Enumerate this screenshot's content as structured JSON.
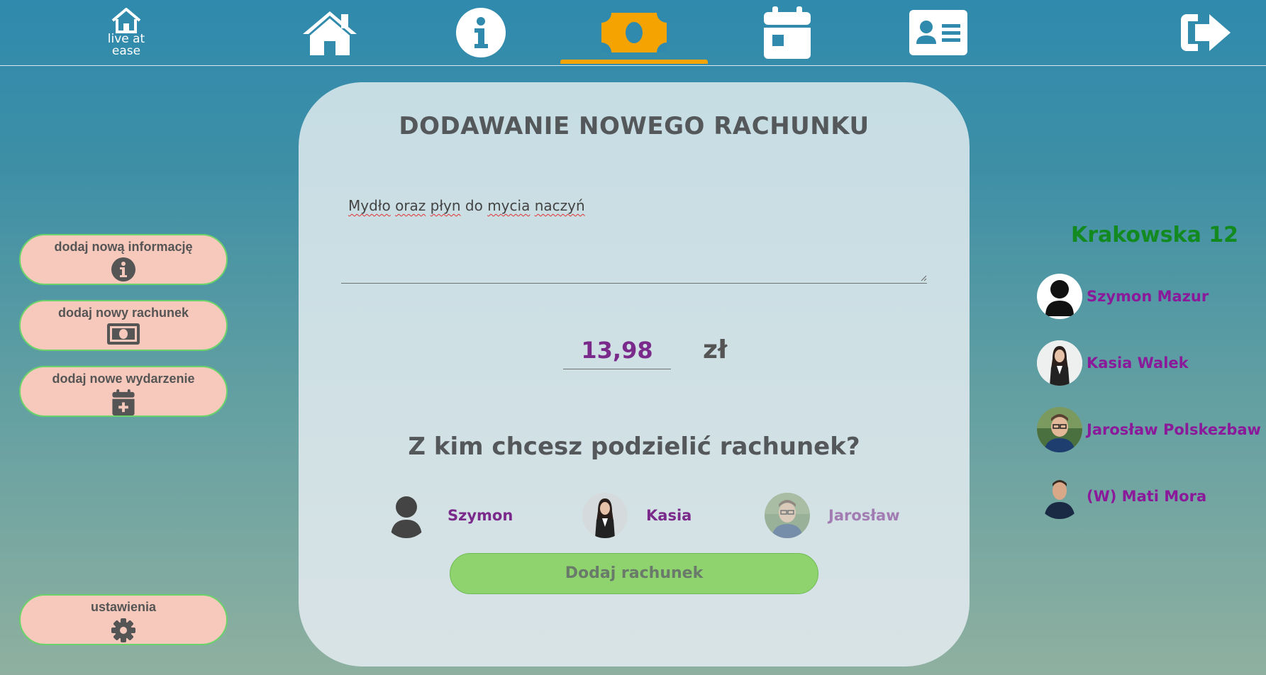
{
  "app": {
    "logo_text": [
      "live at",
      "ease"
    ]
  },
  "nav": {
    "items": [
      {
        "name": "home-icon"
      },
      {
        "name": "info-icon"
      },
      {
        "name": "money-icon",
        "active": true
      },
      {
        "name": "calendar-icon"
      },
      {
        "name": "contact-card-icon"
      },
      {
        "name": "logout-icon"
      }
    ],
    "active_color": "#f5a300"
  },
  "sidebar": {
    "items": [
      {
        "label": "dodaj nową informację",
        "icon": "info-icon"
      },
      {
        "label": "dodaj nowy rachunek",
        "icon": "money-icon"
      },
      {
        "label": "dodaj nowe wydarzenie",
        "icon": "calendar-plus-icon"
      }
    ],
    "settings": {
      "label": "ustawienia",
      "icon": "gear-icon"
    }
  },
  "form": {
    "title": "DODAWANIE NOWEGO RACHUNKU",
    "description_words": [
      "Mydło",
      "oraz",
      "płyn",
      "do",
      "mycia",
      "naczyń"
    ],
    "amount": "13,98",
    "currency": "zł",
    "split_question": "Z kim chcesz podzielić rachunek?",
    "split_people": [
      {
        "name": "Szymon",
        "avatar": "default-user-icon"
      },
      {
        "name": "Kasia",
        "avatar": "kasia-photo"
      },
      {
        "name": "Jarosław",
        "avatar": "jaroslaw-photo"
      }
    ],
    "submit_label": "Dodaj rachunek"
  },
  "household": {
    "address": "Krakowska 12",
    "members": [
      {
        "name": "Szymon Mazur",
        "avatar": "default-user-icon"
      },
      {
        "name": "Kasia Walek",
        "avatar": "kasia-photo"
      },
      {
        "name": "Jarosław Polskezbaw",
        "avatar": "jaroslaw-photo"
      },
      {
        "name": "(W) Mati Mora",
        "avatar": "mati-photo"
      }
    ]
  },
  "colors": {
    "pill_bg": "#f7c9bc",
    "pill_border": "#6ad36a",
    "accent_purple": "#7a2a8a",
    "address_green": "#138a20",
    "submit_green": "#8fd36f"
  }
}
